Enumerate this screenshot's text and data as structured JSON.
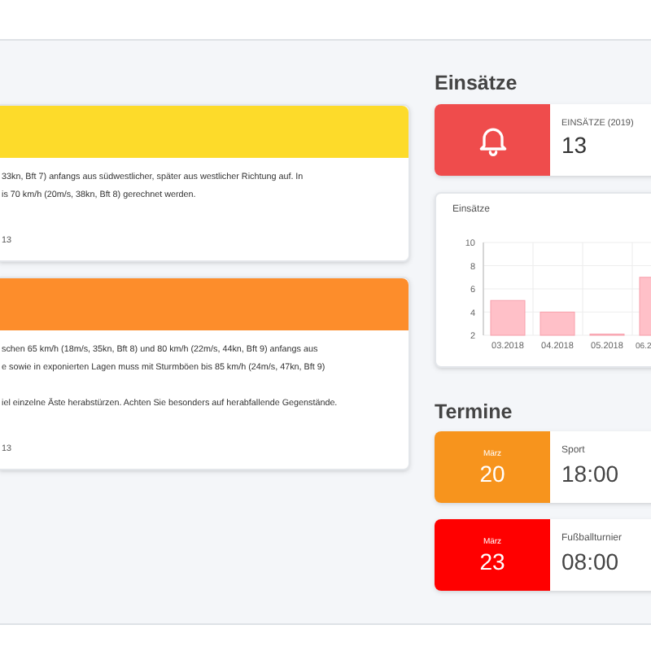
{
  "warnings": [
    {
      "color": "#fddb2a",
      "lines": [
        "33kn, Bft 7) anfangs aus südwestlicher, später aus westlicher Richtung auf. In",
        "is 70 km/h (20m/s, 38kn, Bft 8) gerechnet werden."
      ],
      "footer": "13"
    },
    {
      "color": "#fd8d2b",
      "lines": [
        "schen 65 km/h (18m/s, 35kn, Bft 8) und 80 km/h (22m/s, 44kn, Bft 9) anfangs aus",
        "e sowie in exponierten Lagen muss mit Sturmböen bis 85 km/h (24m/s, 47kn, Bft 9)"
      ],
      "note": "iel einzelne Äste herabstürzen. Achten Sie besonders auf herabfallende Gegenstände.",
      "footer": "13"
    }
  ],
  "einsaetze": {
    "heading": "Einsätze",
    "info": {
      "label": "EINSÄTZE (2019)",
      "value": "13"
    },
    "chart_data": {
      "type": "bar",
      "title": "Einsätze",
      "categories": [
        "03.2018",
        "04.2018",
        "05.2018",
        "06.2"
      ],
      "series": [
        {
          "color": "#ffc0c8",
          "values": [
            5,
            4,
            2.1,
            7
          ]
        }
      ],
      "ylim": [
        2,
        10
      ],
      "yticks": [
        2,
        4,
        6,
        8,
        10
      ],
      "grid": true
    }
  },
  "termine": {
    "heading": "Termine",
    "items": [
      {
        "color": "#f7941d",
        "month": "März",
        "day": "20",
        "title": "Sport",
        "time": "18:00"
      },
      {
        "color": "#ff0000",
        "month": "März",
        "day": "23",
        "title": "Fußballturnier",
        "time": "08:00"
      }
    ]
  }
}
